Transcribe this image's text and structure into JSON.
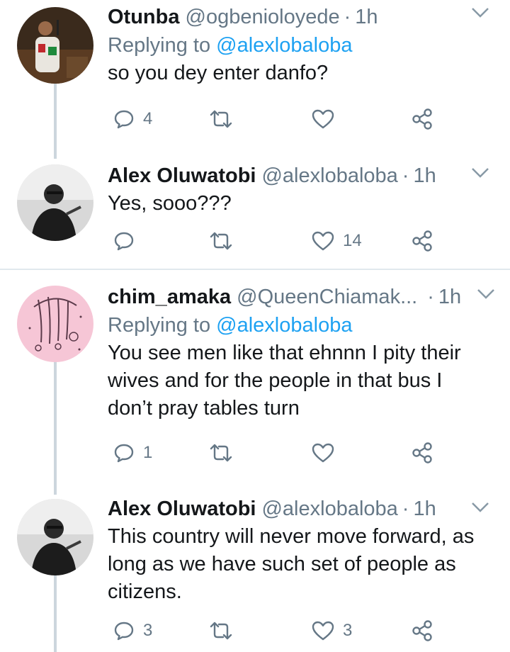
{
  "tweets": [
    {
      "name": "Otunba",
      "handle": "@ogbenioloyede",
      "time": "1h",
      "reply_prefix": "Replying to ",
      "reply_to": "@alexlobaloba",
      "lines": [
        "so you dey enter danfo?"
      ],
      "replies": "4",
      "retweets": "",
      "likes": ""
    },
    {
      "name": "Alex Oluwatobi",
      "handle": "@alexlobaloba",
      "time": "1h",
      "lines": [
        "Yes, sooo???"
      ],
      "replies": "",
      "retweets": "",
      "likes": "14"
    },
    {
      "name": "chim_amaka",
      "handle": "@QueenChiamak...",
      "time": "1h",
      "reply_prefix": "Replying to ",
      "reply_to": "@alexlobaloba",
      "lines": [
        "You see men like that ehnnn I pity their",
        "wives and for the people in that bus I",
        "don’t pray tables turn"
      ],
      "replies": "1",
      "retweets": "",
      "likes": ""
    },
    {
      "name": "Alex Oluwatobi",
      "handle": "@alexlobaloba",
      "time": "1h",
      "lines": [
        "This country will never move forward, as",
        "long as we have such set of people as",
        "citizens."
      ],
      "replies": "3",
      "retweets": "",
      "likes": "3"
    }
  ],
  "separator": "·",
  "icons": {
    "reply": "reply-icon",
    "retweet": "retweet-icon",
    "like": "heart-icon",
    "share": "share-icon",
    "more": "chevron-down-icon"
  },
  "colors": {
    "name": "#14171a",
    "meta": "#657786",
    "mention": "#1da1f2",
    "thread_line": "#ccd6dd",
    "divider": "#e1e8ed"
  }
}
